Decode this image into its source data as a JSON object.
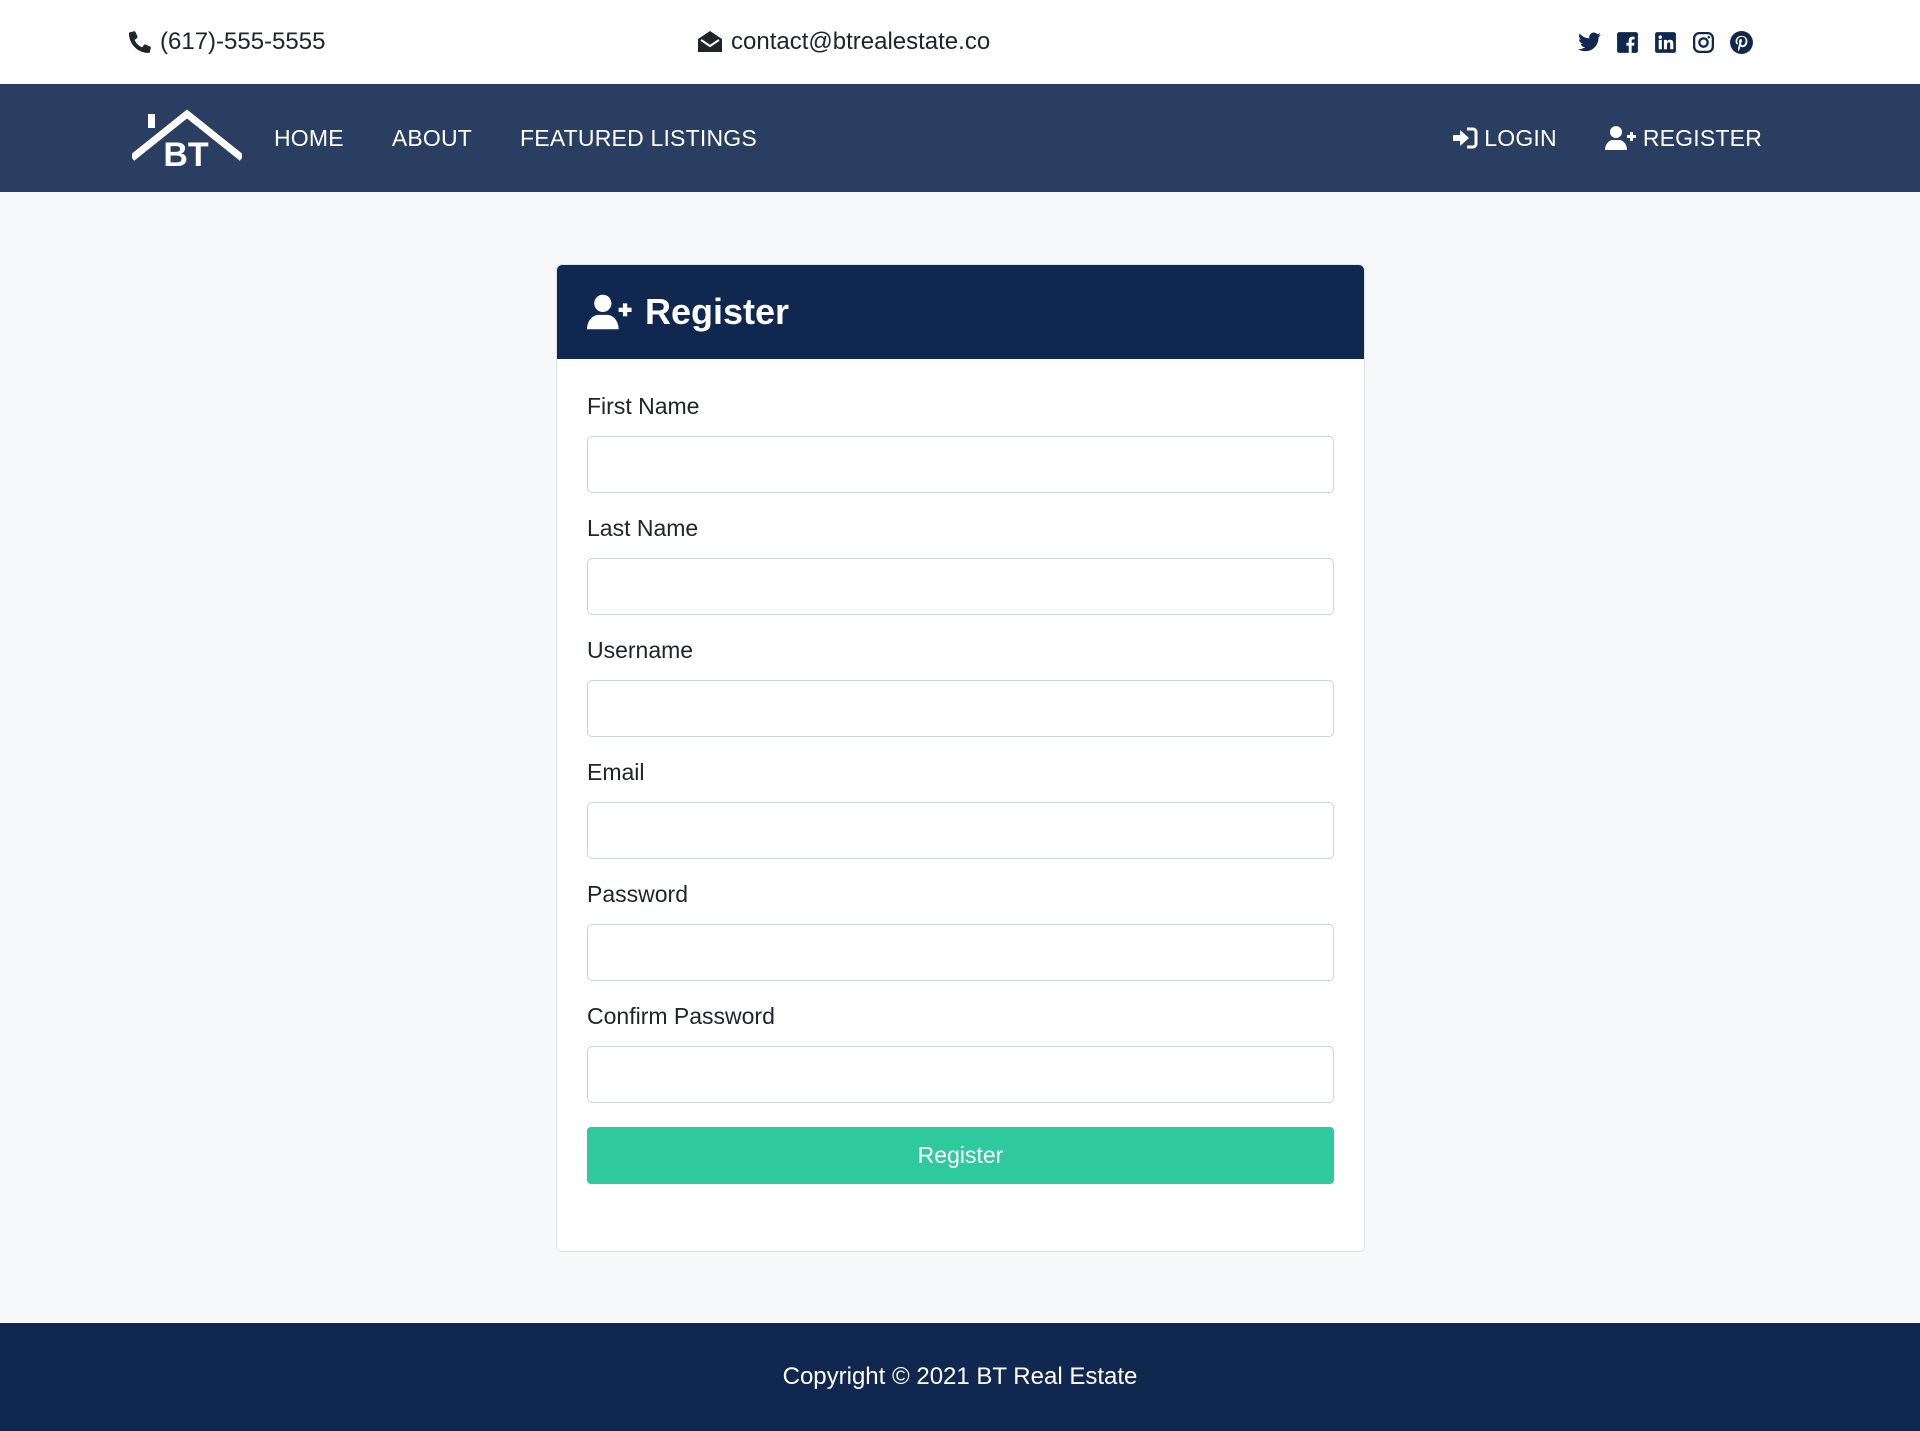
{
  "topbar": {
    "phone_icon": "phone-icon",
    "phone": "(617)-555-5555",
    "email_icon": "envelope-open-icon",
    "email": "contact@btrealestate.co",
    "socials": [
      "twitter-icon",
      "facebook-icon",
      "linkedin-icon",
      "instagram-icon",
      "pinterest-icon"
    ]
  },
  "nav": {
    "logo_text": "BT",
    "links": [
      "HOME",
      "ABOUT",
      "FEATURED LISTINGS"
    ],
    "login_label": "LOGIN",
    "register_label": "REGISTER"
  },
  "form": {
    "title": "Register",
    "fields": {
      "first_name": "First Name",
      "last_name": "Last Name",
      "username": "Username",
      "email": "Email",
      "password": "Password",
      "confirm_password": "Confirm Password"
    },
    "submit_label": "Register"
  },
  "footer": {
    "copyright": "Copyright © 2021 BT Real Estate"
  },
  "colors": {
    "topbar_bg": "#ffffff",
    "nav_bg": "#293e61",
    "header_bg": "#10284f",
    "footer_bg": "#10284f",
    "button": "#2fc99e",
    "page_bg": "#f6f8fa"
  }
}
